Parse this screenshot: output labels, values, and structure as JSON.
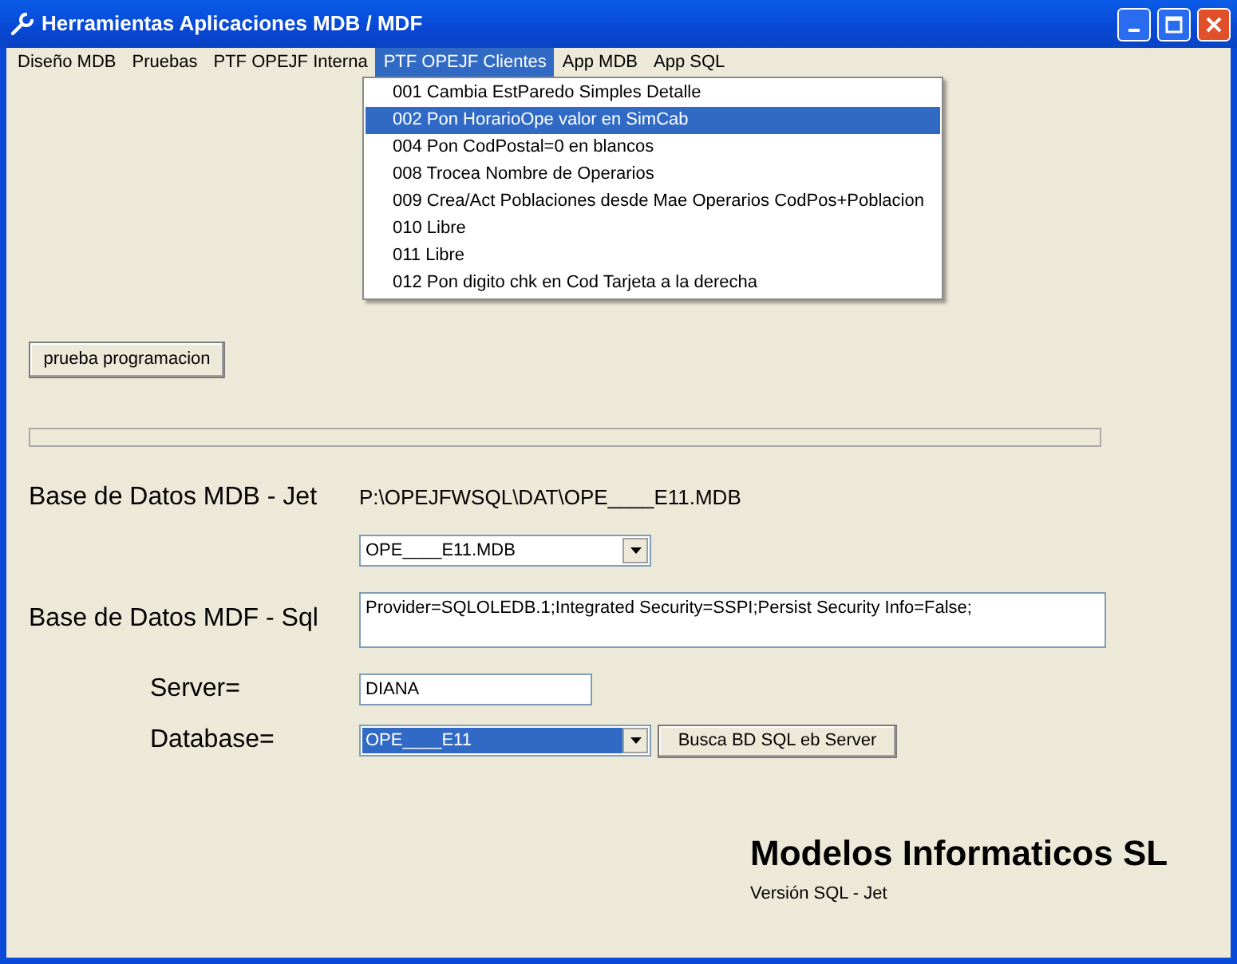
{
  "window": {
    "title": "Herramientas Aplicaciones MDB / MDF"
  },
  "menu": [
    {
      "label": "Diseño MDB",
      "selected": false
    },
    {
      "label": "Pruebas",
      "selected": false
    },
    {
      "label": "PTF OPEJF Interna",
      "selected": false
    },
    {
      "label": "PTF OPEJF Clientes",
      "selected": true
    },
    {
      "label": "App MDB",
      "selected": false
    },
    {
      "label": "App SQL",
      "selected": false
    }
  ],
  "dropdown": [
    {
      "label": "001 Cambia EstParedo Simples Detalle",
      "selected": false
    },
    {
      "label": "002 Pon HorarioOpe valor en SimCab",
      "selected": true
    },
    {
      "label": "004 Pon CodPostal=0 en blancos",
      "selected": false
    },
    {
      "label": "008 Trocea Nombre de Operarios",
      "selected": false
    },
    {
      "label": "009 Crea/Act Poblaciones desde Mae Operarios CodPos+Poblacion",
      "selected": false
    },
    {
      "label": "010 Libre",
      "selected": false
    },
    {
      "label": "011 Libre",
      "selected": false
    },
    {
      "label": "012 Pon digito chk en Cod Tarjeta a la derecha",
      "selected": false
    }
  ],
  "test_button": "prueba programacion",
  "progress": {
    "level": 0
  },
  "mdb": {
    "label": "Base de Datos MDB - Jet",
    "path": "P:\\OPEJFWSQL\\DAT\\OPE____E11.MDB",
    "combo": {
      "value": "OPE____E11.MDB",
      "highlighted": false
    }
  },
  "mdf": {
    "label": "Base de Datos MDF - Sql",
    "connection": "Provider=SQLOLEDB.1;Integrated Security=SSPI;Persist Security Info=False;"
  },
  "server": {
    "label": "Server=",
    "value": "DIANA"
  },
  "database": {
    "label": "Database=",
    "combo": {
      "value": "OPE____E11",
      "highlighted": true
    },
    "button": "Busca BD SQL eb Server"
  },
  "company": {
    "name": "Modelos Informaticos SL",
    "version": "Versión SQL - Jet"
  }
}
